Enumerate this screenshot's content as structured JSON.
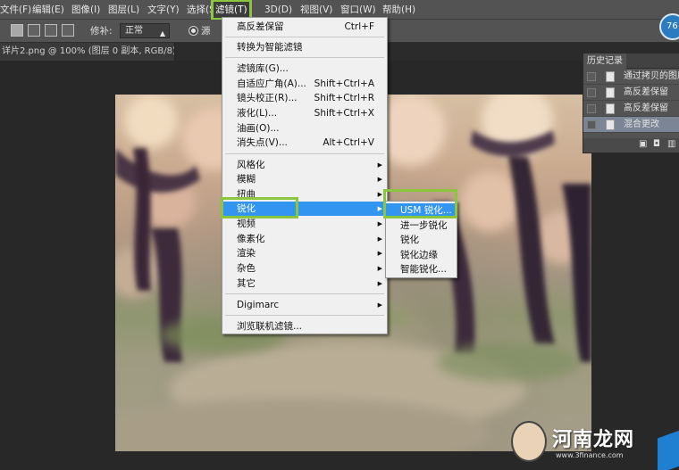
{
  "menubar": {
    "items": [
      "文件(F)",
      "编辑(E)",
      "图像(I)",
      "图层(L)",
      "文字(Y)",
      "选择(S",
      "滤镜(T)",
      "3D(D)",
      "视图(V)",
      "窗口(W)",
      "帮助(H)"
    ]
  },
  "options": {
    "patch_label": "修补:",
    "mode_value": "正常",
    "source_label": "源"
  },
  "document": {
    "tab_title": "详片2.png @ 100% (图层 0 副本, RGB/8) *",
    "close": "×"
  },
  "filter_menu": {
    "items": [
      {
        "label": "高反差保留",
        "shortcut": "Ctrl+F"
      },
      {
        "label": "转换为智能滤镜",
        "shortcut": ""
      },
      {
        "label": "滤镜库(G)...",
        "shortcut": ""
      },
      {
        "label": "自适应广角(A)...",
        "shortcut": "Shift+Ctrl+A"
      },
      {
        "label": "镜头校正(R)...",
        "shortcut": "Shift+Ctrl+R"
      },
      {
        "label": "液化(L)...",
        "shortcut": "Shift+Ctrl+X"
      },
      {
        "label": "油画(O)...",
        "shortcut": ""
      },
      {
        "label": "消失点(V)...",
        "shortcut": "Alt+Ctrl+V"
      },
      {
        "label": "风格化",
        "shortcut": ""
      },
      {
        "label": "模糊",
        "shortcut": ""
      },
      {
        "label": "扭曲",
        "shortcut": ""
      },
      {
        "label": "锐化",
        "shortcut": ""
      },
      {
        "label": "视频",
        "shortcut": ""
      },
      {
        "label": "像素化",
        "shortcut": ""
      },
      {
        "label": "渲染",
        "shortcut": ""
      },
      {
        "label": "杂色",
        "shortcut": ""
      },
      {
        "label": "其它",
        "shortcut": ""
      },
      {
        "label": "Digimarc",
        "shortcut": ""
      },
      {
        "label": "浏览联机滤镜...",
        "shortcut": ""
      }
    ],
    "highlighted": "锐化"
  },
  "sharpen_submenu": {
    "items": [
      "USM 锐化...",
      "进一步锐化",
      "锐化",
      "锐化边缘",
      "智能锐化..."
    ],
    "highlighted": "USM 锐化..."
  },
  "history_panel": {
    "title": "历史记录",
    "items": [
      "通过拷贝的图层",
      "高反差保留",
      "高反差保留",
      "混合更改"
    ],
    "current": "混合更改"
  },
  "badge": {
    "text": "76"
  },
  "watermark": {
    "text": "河南龙网",
    "url": "www.3finance.com"
  },
  "colors": {
    "accent_highlight": "#8cc63f",
    "menu_selection": "#3296f0",
    "history_current": "#7b8595"
  }
}
